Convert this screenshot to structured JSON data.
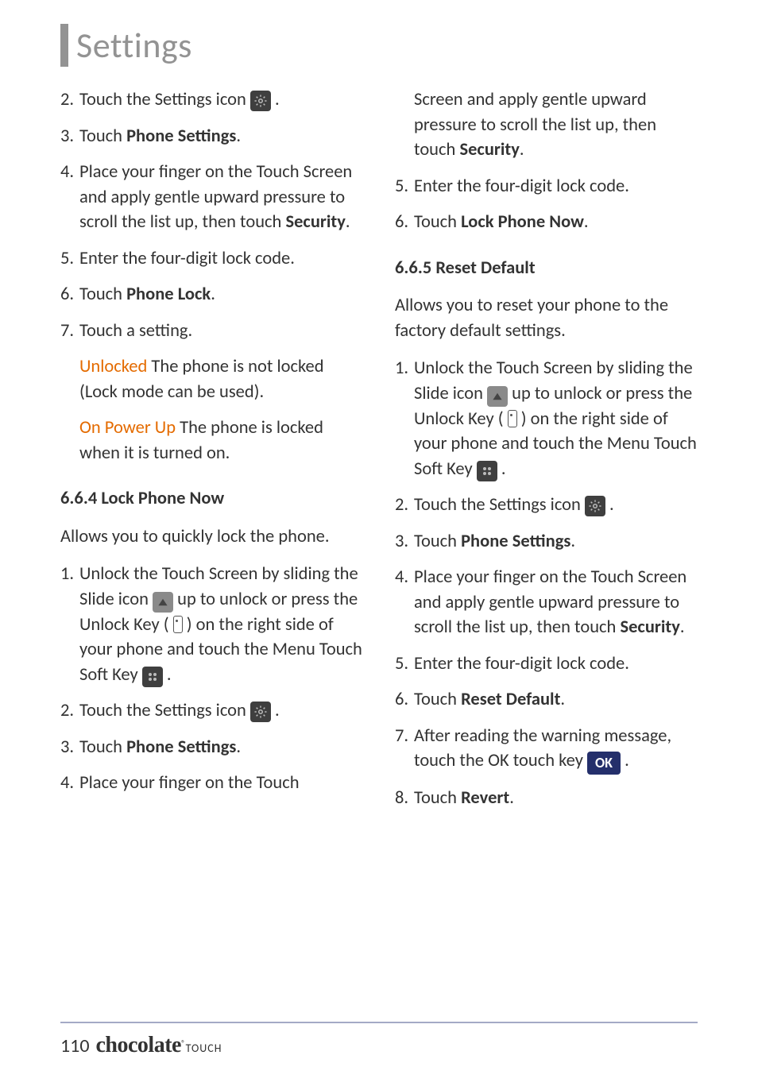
{
  "header": {
    "title": "Settings"
  },
  "left": {
    "s2_a": "Touch the Settings icon ",
    "s2_b": " .",
    "s3_a": "Touch ",
    "s3_b": "Phone Settings",
    "s3_c": ".",
    "s4_a": "Place your finger on the Touch Screen and apply gentle upward pressure to scroll the list up, then touch ",
    "s4_b": "Security",
    "s4_c": ".",
    "s5": "Enter the four-digit lock code.",
    "s6_a": "Touch ",
    "s6_b": "Phone Lock",
    "s6_c": ".",
    "s7": "Touch a setting.",
    "unlocked_label": "Unlocked",
    "unlocked_txt": "  The phone is not locked (Lock mode can be used).",
    "powerup_label": "On Power Up",
    "powerup_txt": "  The phone is locked when  it is turned on.",
    "sub664": "6.6.4 Lock Phone Now",
    "intro664": "Allows you to quickly lock the phone.",
    "l1_a": "Unlock the Touch Screen by sliding the Slide icon ",
    "l1_b": " up to unlock or press the Unlock Key ( ",
    "l1_c": " ) on the right side of your phone and touch the Menu Touch Soft Key ",
    "l1_d": " .",
    "l2_a": "Touch the Settings icon ",
    "l2_b": " .",
    "l3_a": "Touch ",
    "l3_b": "Phone Settings",
    "l3_c": ".",
    "l4": "Place your finger on the Touch"
  },
  "right": {
    "cont_a": "Screen and apply gentle upward pressure to scroll the list up, then touch ",
    "cont_b": "Security",
    "cont_c": ".",
    "r5": "Enter the four-digit lock code.",
    "r6_a": "Touch ",
    "r6_b": "Lock Phone Now",
    "r6_c": ".",
    "sub665": "6.6.5 Reset Default",
    "intro665": "Allows you to reset your phone to the factory default settings.",
    "d1_a": "Unlock the Touch Screen by sliding the Slide icon ",
    "d1_b": " up to unlock or press the Unlock Key ( ",
    "d1_c": " ) on the right side of your phone and touch the Menu Touch Soft Key ",
    "d1_d": " .",
    "d2_a": "Touch the Settings icon ",
    "d2_b": " .",
    "d3_a": "Touch ",
    "d3_b": "Phone Settings",
    "d3_c": ".",
    "d4_a": "Place your finger on the Touch Screen and apply gentle upward pressure to scroll the list up, then touch ",
    "d4_b": "Security",
    "d4_c": ".",
    "d5": "Enter the four-digit lock code.",
    "d6_a": "Touch ",
    "d6_b": "Reset Default",
    "d6_c": ".",
    "d7_a": "After reading the warning message, touch the OK touch key ",
    "d7_b": " .",
    "d8_a": "Touch ",
    "d8_b": "Revert",
    "d8_c": "."
  },
  "nums": {
    "n1": "1.",
    "n2": "2.",
    "n3": "3.",
    "n4": "4.",
    "n5": "5.",
    "n6": "6.",
    "n7": "7.",
    "n8": "8."
  },
  "icons": {
    "ok": "OK"
  },
  "footer": {
    "page": "110",
    "brand": "chocolate",
    "reg": "®",
    "sub": "TOUCH"
  }
}
